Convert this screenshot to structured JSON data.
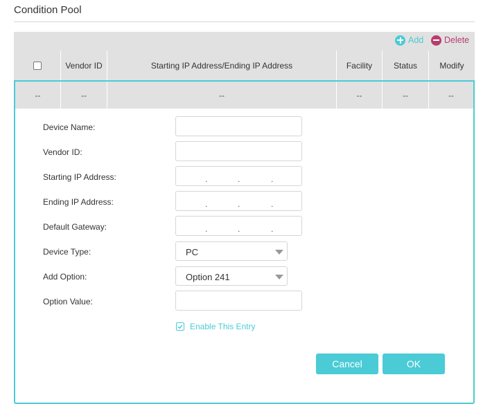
{
  "page": {
    "title": "Condition Pool"
  },
  "toolbar": {
    "add_label": "Add",
    "delete_label": "Delete"
  },
  "table": {
    "columns": [
      "Vendor ID",
      "Starting IP Address/Ending IP Address",
      "Facility",
      "Status",
      "Modify"
    ],
    "row": [
      "--",
      "--",
      "--",
      "--",
      "--",
      "--"
    ]
  },
  "form": {
    "device_name_label": "Device Name:",
    "vendor_id_label": "Vendor ID:",
    "starting_ip_label": "Starting IP Address:",
    "ending_ip_label": "Ending IP Address:",
    "default_gateway_label": "Default Gateway:",
    "device_type_label": "Device Type:",
    "device_type_value": "PC",
    "add_option_label": "Add Option:",
    "add_option_value": "Option 241",
    "option_value_label": "Option Value:",
    "enable_entry_label": "Enable This Entry",
    "ip_dot": "."
  },
  "buttons": {
    "cancel": "Cancel",
    "ok": "OK"
  },
  "colors": {
    "accent": "#4acbd6",
    "delete": "#b83c6e",
    "header_bg": "#e1e1e1"
  },
  "icons": {
    "add": "plus-circle-icon",
    "delete": "minus-circle-icon",
    "check": "checkmark-icon"
  }
}
